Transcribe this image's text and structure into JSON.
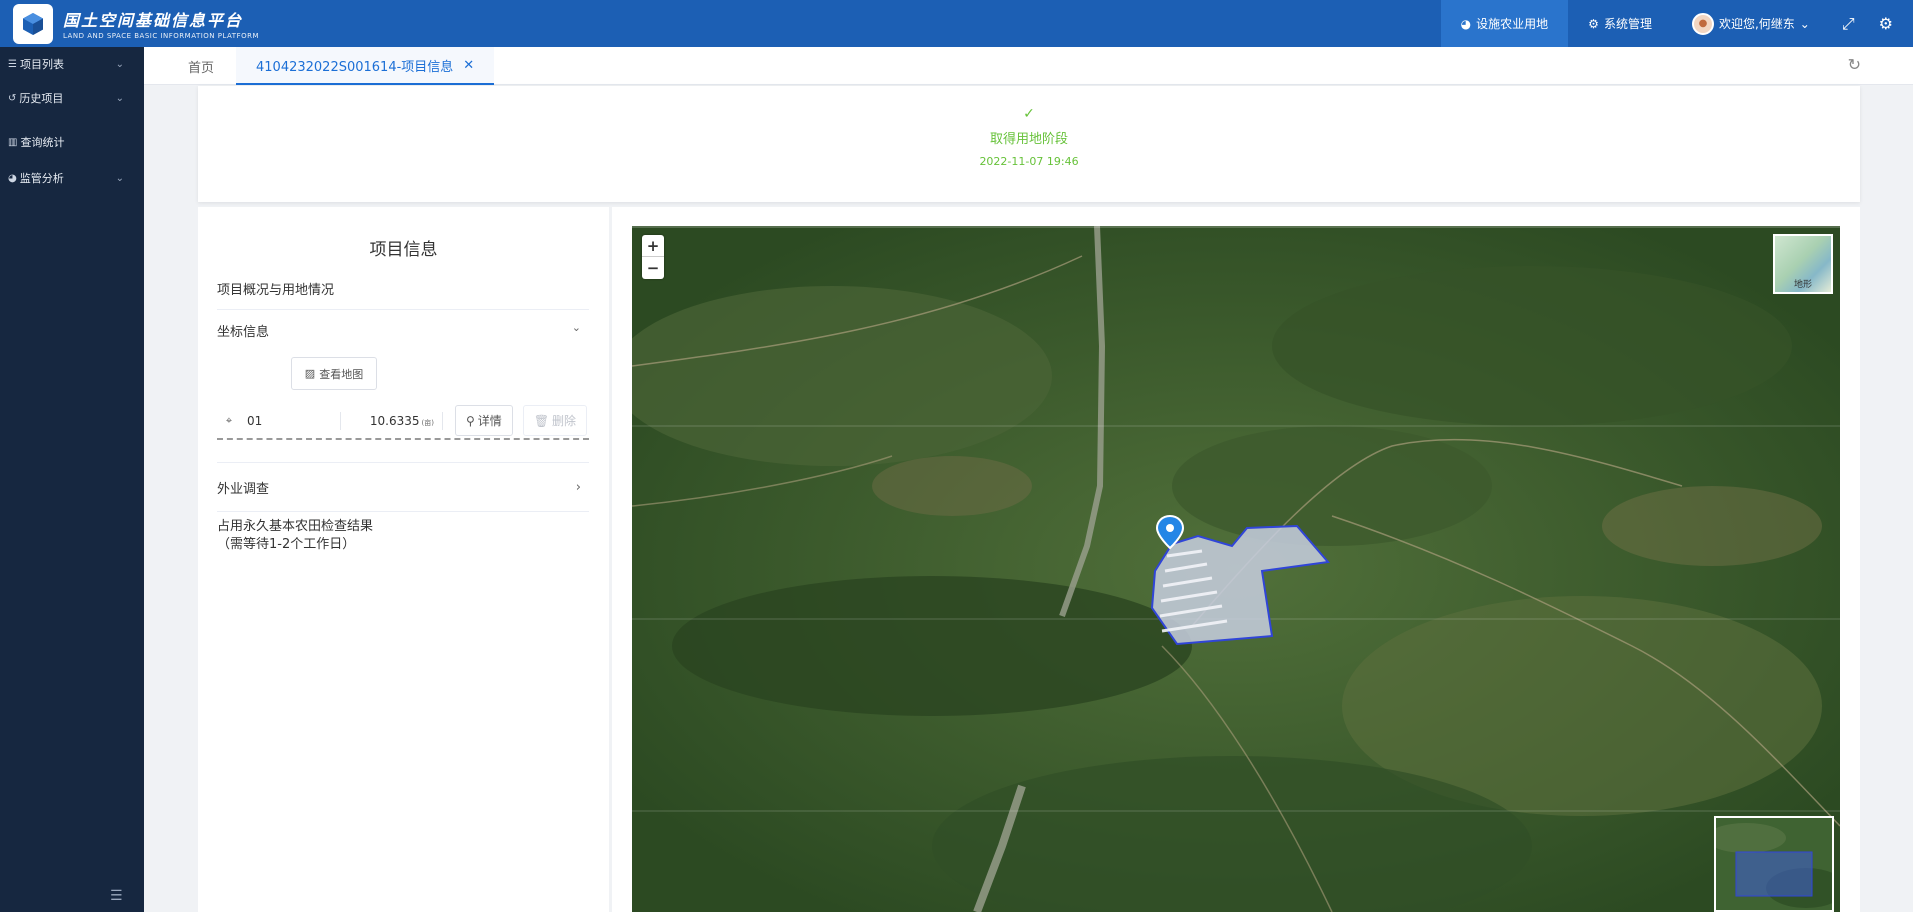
{
  "header": {
    "title_cn": "国土空间基础信息平台",
    "title_en": "LAND AND SPACE BASIC INFORMATION PLATFORM",
    "nav": [
      {
        "label": "设施农业用地",
        "active": true
      },
      {
        "label": "系统管理",
        "active": false
      }
    ],
    "welcome": "欢迎您,何继东"
  },
  "sidebar": {
    "items": [
      {
        "label": "项目列表",
        "icon": "list-icon",
        "expandable": true
      },
      {
        "label": "历史项目",
        "icon": "history-icon",
        "expandable": true
      },
      {
        "label": "查询统计",
        "icon": "chart-icon",
        "expandable": false
      },
      {
        "label": "监管分析",
        "icon": "pie-icon",
        "expandable": true
      }
    ]
  },
  "tabs": {
    "home": "首页",
    "active": "4104232022S001614-项目信息"
  },
  "status": {
    "label": "取得用地阶段",
    "time": "2022-11-07 19:46"
  },
  "info": {
    "title": "项目信息",
    "overview": "项目概况与用地情况",
    "coord_section": "坐标信息",
    "view_map_button": "查看地图",
    "coord_row": {
      "number": "01",
      "area": "10.6335",
      "unit": "(亩)",
      "detail_button": "详情",
      "delete_button": "删除"
    },
    "field_survey": "外业调查",
    "farmland_title": "占用永久基本农田检查结果",
    "farmland_note": "（需等待1-2个工作日）"
  },
  "map": {
    "layer_label": "地形",
    "zoom_in": "+",
    "zoom_out": "−"
  },
  "colors": {
    "header_bg": "#1c5fb4",
    "sidebar_bg": "#162740",
    "accent": "#1c6fd6",
    "success": "#67c23a",
    "parcel_stroke": "#3045d8"
  }
}
